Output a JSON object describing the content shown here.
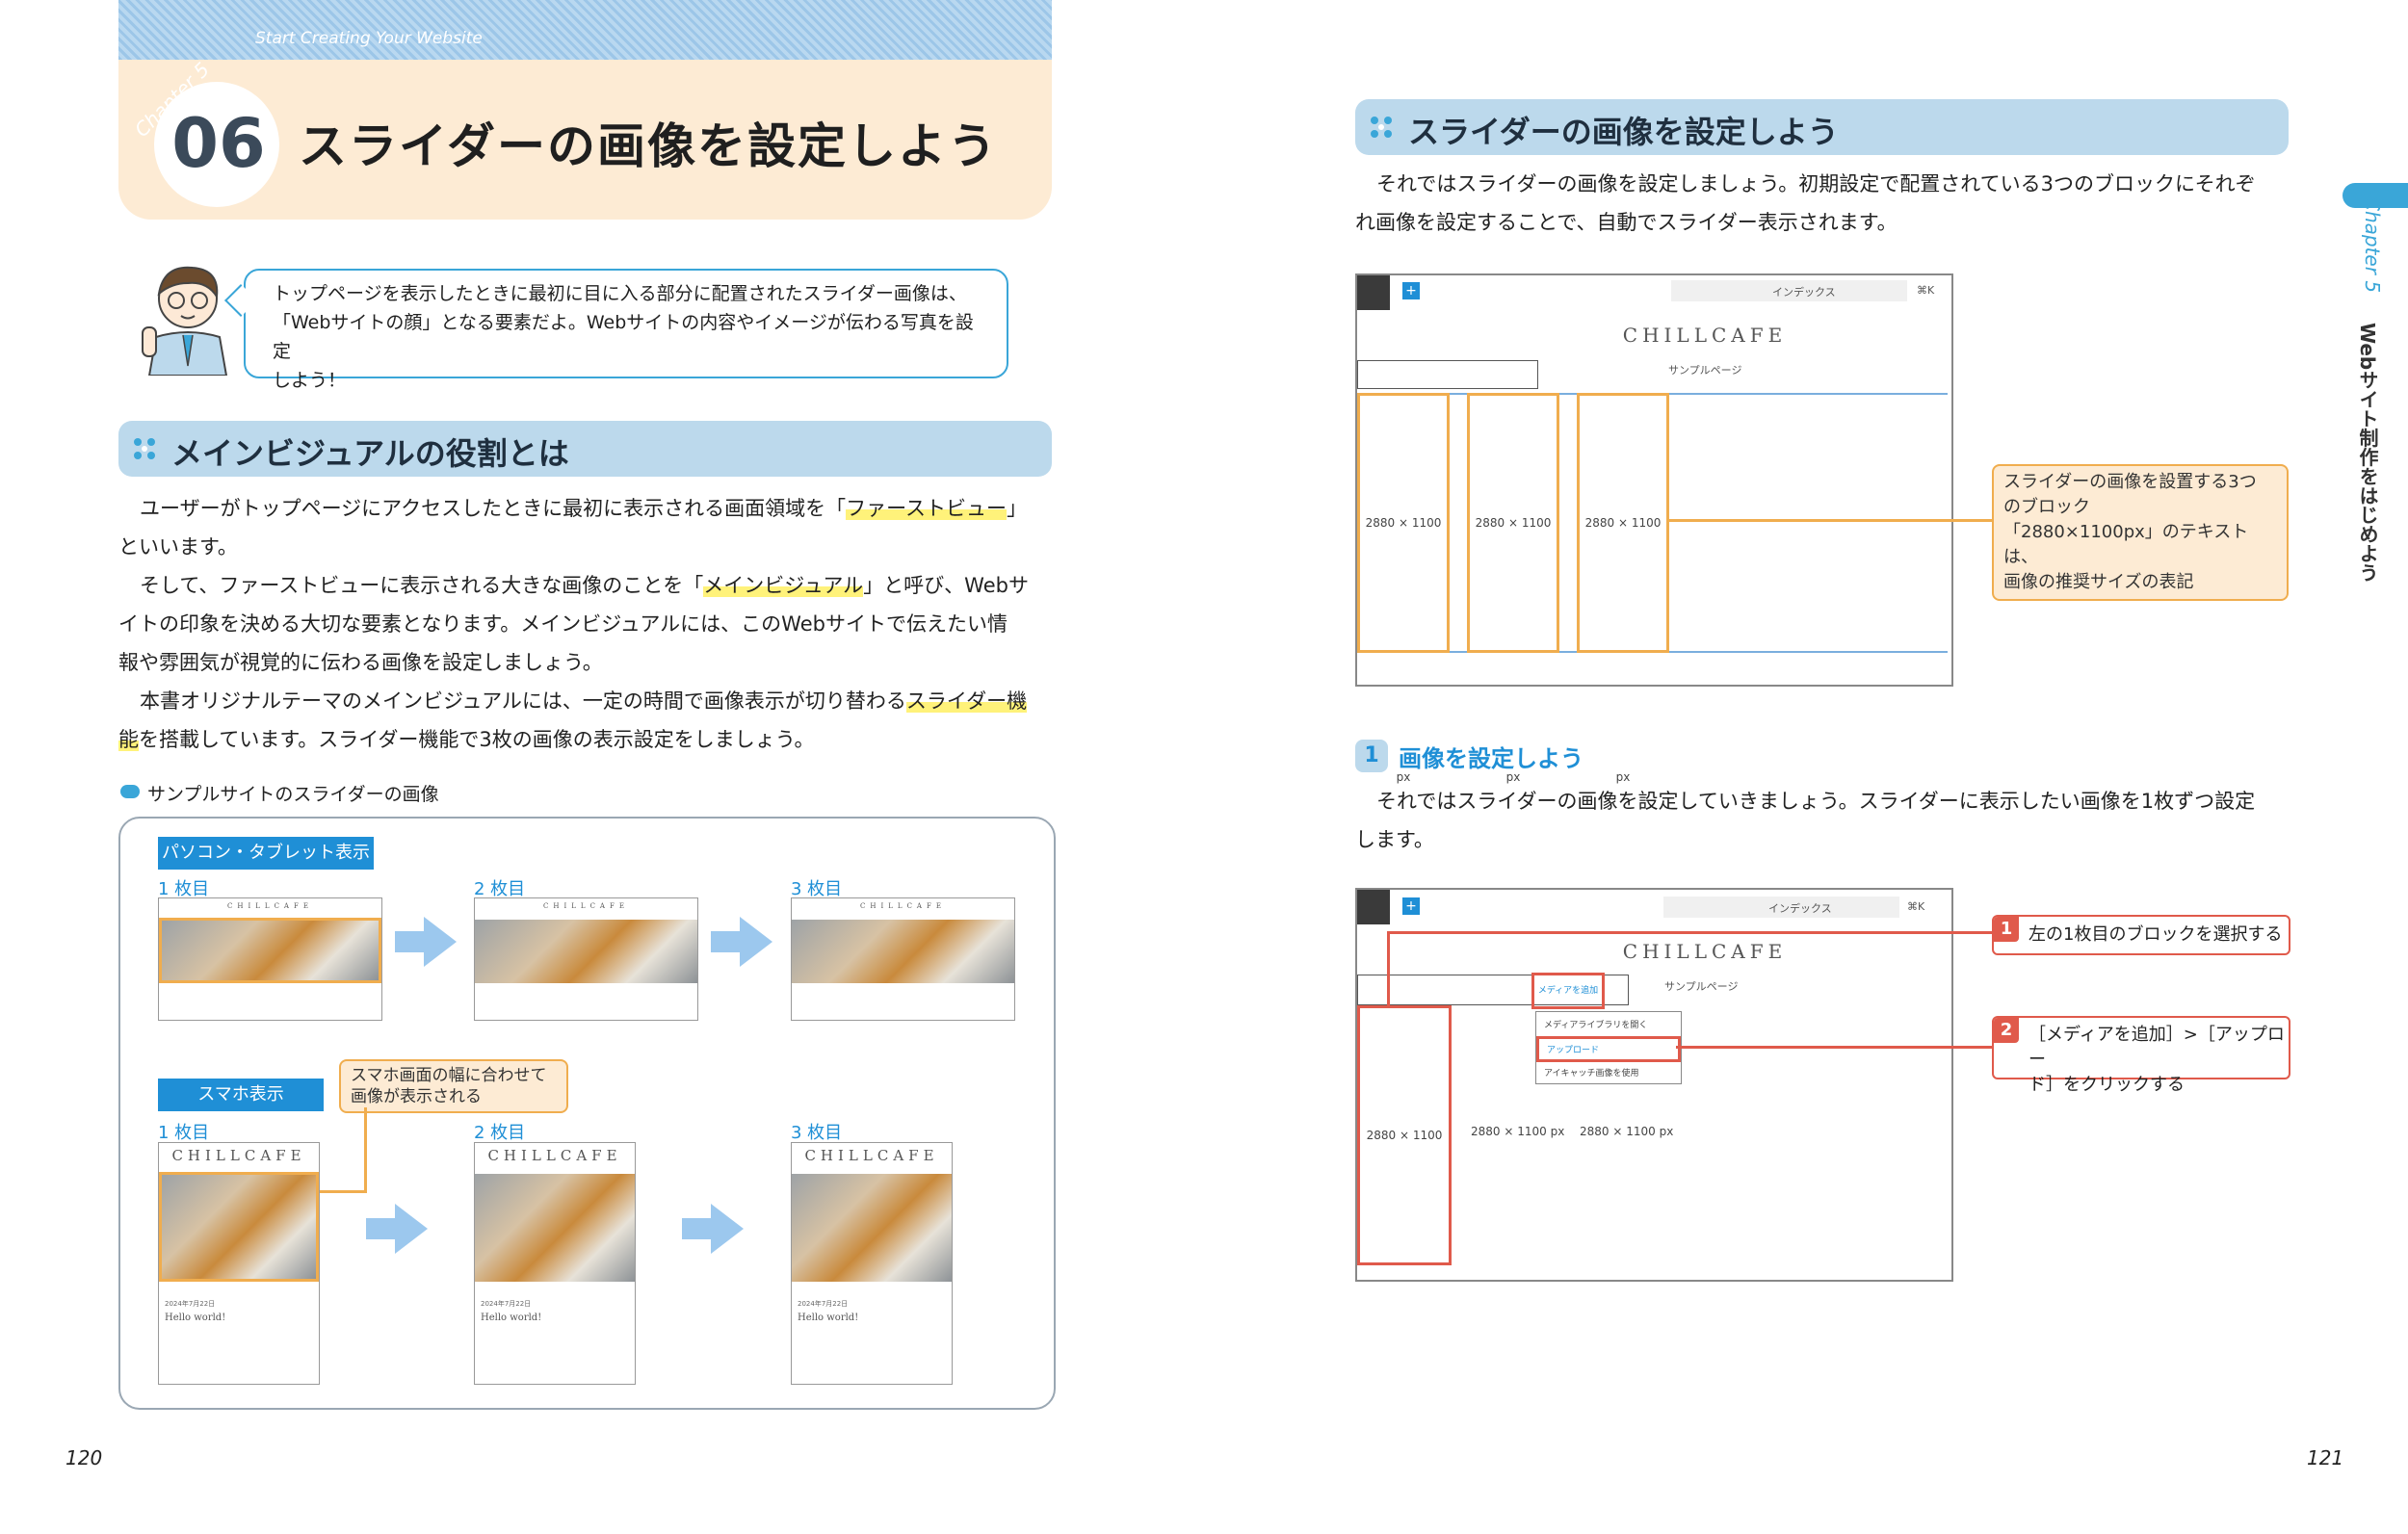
{
  "header": {
    "subtitle": "Start Creating Your Website",
    "chapter_tag": "Chapter 5",
    "number": "06",
    "title": "スライダーの画像を設定しよう"
  },
  "speech": {
    "line1": "トップページを表示したときに最初に目に入る部分に配置されたスライダー画像は、",
    "line2": "「Webサイトの顔」となる要素だよ。Webサイトの内容やイメージが伝わる写真を設定",
    "line3": "しよう！"
  },
  "section1": {
    "title": "メインビジュアルの役割とは",
    "p1a": "ユーザーがトップページにアクセスしたときに最初に表示される画面領域を「",
    "p1hl": "ファーストビュー",
    "p1b": "」",
    "p1c": "といいます。",
    "p2a": "そして、ファーストビューに表示される大きな画像のことを「",
    "p2hl": "メインビジュアル",
    "p2b": "」と呼び、Webサ",
    "p2c": "イトの印象を決める大切な要素となります。メインビジュアルには、このWebサイトで伝えたい情",
    "p2d": "報や雰囲気が視覚的に伝わる画像を設定しましょう。",
    "p3a": "本書オリジナルテーマのメインビジュアルには、一定の時間で画像表示が切り替わる",
    "p3hl1": "スライダー機",
    "p3hl2": "能",
    "p3b": "を搭載しています。スライダー機能で3枚の画像の表示設定をしましょう。"
  },
  "sample": {
    "caption": "サンプルサイトのスライダーの画像",
    "pc_tag": "パソコン・タブレット表示",
    "sp_tag": "スマホ表示",
    "labels": [
      "1 枚目",
      "2 枚目",
      "3 枚目"
    ],
    "sp_note_line1": "スマホ画面の幅に合わせて",
    "sp_note_line2": "画像が表示される",
    "logo": "CHILLCAFE",
    "post_date": "2024年7月22日",
    "post_title": "Hello world!"
  },
  "right": {
    "section_title": "スライダーの画像を設定しよう",
    "p1a": "それではスライダーの画像を設定しましょう。初期設定で配置されている3つのブロックにそれぞ",
    "p1b": "れ画像を設定することで、自動でスライダー表示されます。",
    "editor1": {
      "doc_label": "インデックス",
      "shortcut": "⌘K",
      "logo": "CHILLCAFE",
      "menu": "サンプルページ",
      "block_label": "2880 × 1100 px",
      "note_line1": "スライダーの画像を設置する3つ",
      "note_line2": "のブロック",
      "note_line3": "「2880×1100px」のテキストは、",
      "note_line4": "画像の推奨サイズの表記"
    },
    "step": {
      "num": "1",
      "title": "画像を設定しよう",
      "p1a": "それではスライダーの画像を設定していきましょう。スライダーに表示したい画像を1枚ずつ設定",
      "p1b": "します。"
    },
    "editor2": {
      "doc_label": "インデックス",
      "shortcut": "⌘K",
      "logo": "CHILLCAFE",
      "menu": "サンプルページ",
      "add_media": "メディアを追加",
      "menu_items": [
        "メディアライブラリを開く",
        "アップロード",
        "アイキャッチ画像を使用"
      ],
      "block1": "2880 × 1100",
      "block2": "2880 × 1100 px",
      "block3": "2880 × 1100 px",
      "callout1_num": "1",
      "callout1": "左の1枚目のブロックを選択する",
      "callout2_num": "2",
      "callout2_line1": "［メディアを追加］>［アップロー",
      "callout2_line2": "ド］をクリックする"
    },
    "side_chapter": "Chapter 5",
    "side_label": "Webサイト制作をはじめよう"
  },
  "pages": {
    "left": "120",
    "right": "121"
  },
  "colors": {
    "accent_blue": "#3aa6d8",
    "orange": "#f0ad4e",
    "red": "#e05a4b",
    "section_bg": "#bcd9ec",
    "header_bg": "#fdebd4"
  }
}
